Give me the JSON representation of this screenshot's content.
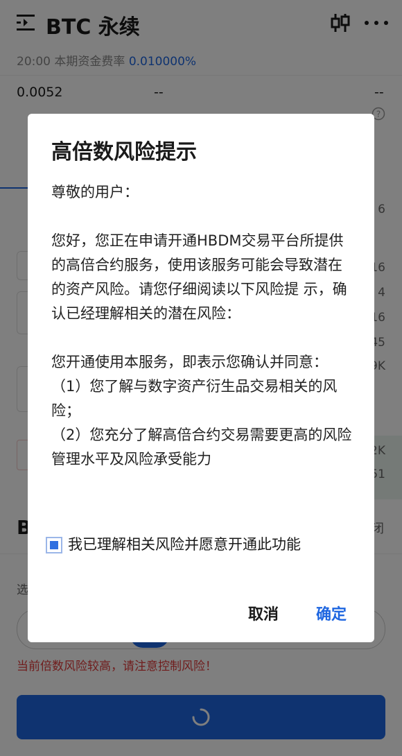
{
  "header": {
    "title": "BTC 永续",
    "menu_icon": "menu-icon",
    "chart_icon": "chart-icon",
    "more_icon": "more-icon"
  },
  "funding": {
    "label": "20:00 本期资金费率",
    "rate": "0.010000%"
  },
  "stats": {
    "values": [
      "0.0052",
      "--",
      "--"
    ]
  },
  "background": {
    "right_numbers": [
      "6",
      "16",
      "4",
      "16",
      "45",
      "9K",
      "2K",
      "51"
    ],
    "section_letter": "B",
    "close_label": "闭",
    "select_label": "选",
    "warning": "当前倍数风险较高，请注意控制风险！"
  },
  "dialog": {
    "title": "高倍数风险提示",
    "paragraphs": [
      "尊敬的用户：",
      "您好，您正在申请开通HBDM交易平台所提供的高倍合约服务，使用该服务可能会导致潜在的资产风险。请您仔细阅读以下风险提 示，确认已经理解相关的潜在风险：",
      "您开通使用本服务，即表示您确认并同意：",
      "（1）您了解与数字资产衍生品交易相关的风险；",
      "（2）您充分了解高倍合约交易需要更高的风险管理水平及风险承受能力"
    ],
    "checkbox_label": "我已理解相关风险并愿意开通此功能",
    "checkbox_checked": true,
    "cancel_label": "取消",
    "confirm_label": "确定"
  },
  "colors": {
    "accent": "#1e66e0",
    "warning": "#e03a3a",
    "overlay": "rgba(0,0,0,0.5)"
  }
}
